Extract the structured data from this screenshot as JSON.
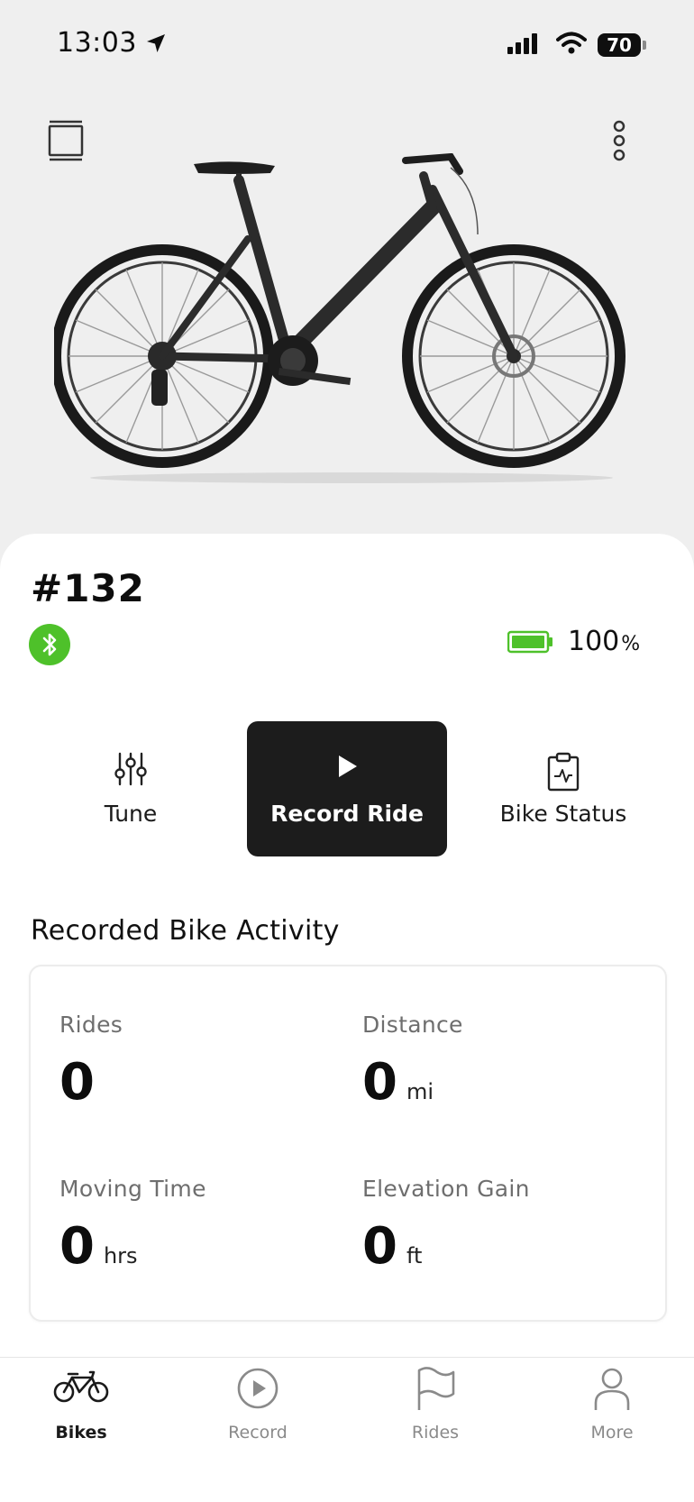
{
  "status_bar": {
    "time": "13:03",
    "battery": "70"
  },
  "header": {
    "left_icon": "bike-switcher-icon",
    "right_icon": "more-vertical-icon"
  },
  "bike": {
    "name": "#132",
    "battery_level": "100",
    "battery_unit": "%",
    "connection": "bluetooth-connected"
  },
  "actions": [
    {
      "label": "Tune",
      "icon": "sliders-icon"
    },
    {
      "label": "Record Ride",
      "icon": "play-icon"
    },
    {
      "label": "Bike Status",
      "icon": "clipboard-pulse-icon"
    }
  ],
  "activity": {
    "title": "Recorded Bike Activity",
    "stats": [
      {
        "label": "Rides",
        "value": "0",
        "unit": ""
      },
      {
        "label": "Distance",
        "value": "0",
        "unit": "mi"
      },
      {
        "label": "Moving Time",
        "value": "0",
        "unit": "hrs"
      },
      {
        "label": "Elevation Gain",
        "value": "0",
        "unit": "ft"
      }
    ]
  },
  "tabs": [
    {
      "label": "Bikes",
      "icon": "bike-icon",
      "active": true
    },
    {
      "label": "Record",
      "icon": "record-play-icon",
      "active": false
    },
    {
      "label": "Rides",
      "icon": "flag-icon",
      "active": false
    },
    {
      "label": "More",
      "icon": "person-icon",
      "active": false
    }
  ],
  "colors": {
    "accent_green": "#4ec12a",
    "record_button": "#1c1c1c",
    "hero_bg": "#efefef"
  }
}
